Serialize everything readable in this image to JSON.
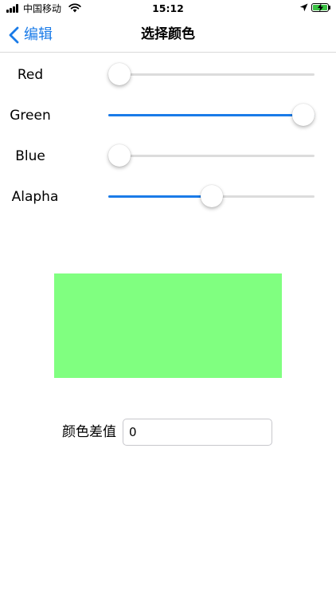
{
  "status_bar": {
    "carrier": "中国移动",
    "time": "15:12",
    "battery_color": "#3ac243",
    "icons": [
      "signal-icon",
      "wifi-icon",
      "location-icon",
      "battery-icon",
      "charging-bolt-icon"
    ]
  },
  "nav": {
    "back_label": "编辑",
    "title": "选择颜色",
    "accent_color": "#1a7be8"
  },
  "sliders": [
    {
      "label": "Red",
      "value": 0.0
    },
    {
      "label": "Green",
      "value": 1.0
    },
    {
      "label": "Blue",
      "value": 0.0
    },
    {
      "label": "Alapha",
      "value": 0.5
    }
  ],
  "preview": {
    "color": "#80ff80"
  },
  "difference": {
    "label": "颜色差值",
    "value": "0"
  }
}
